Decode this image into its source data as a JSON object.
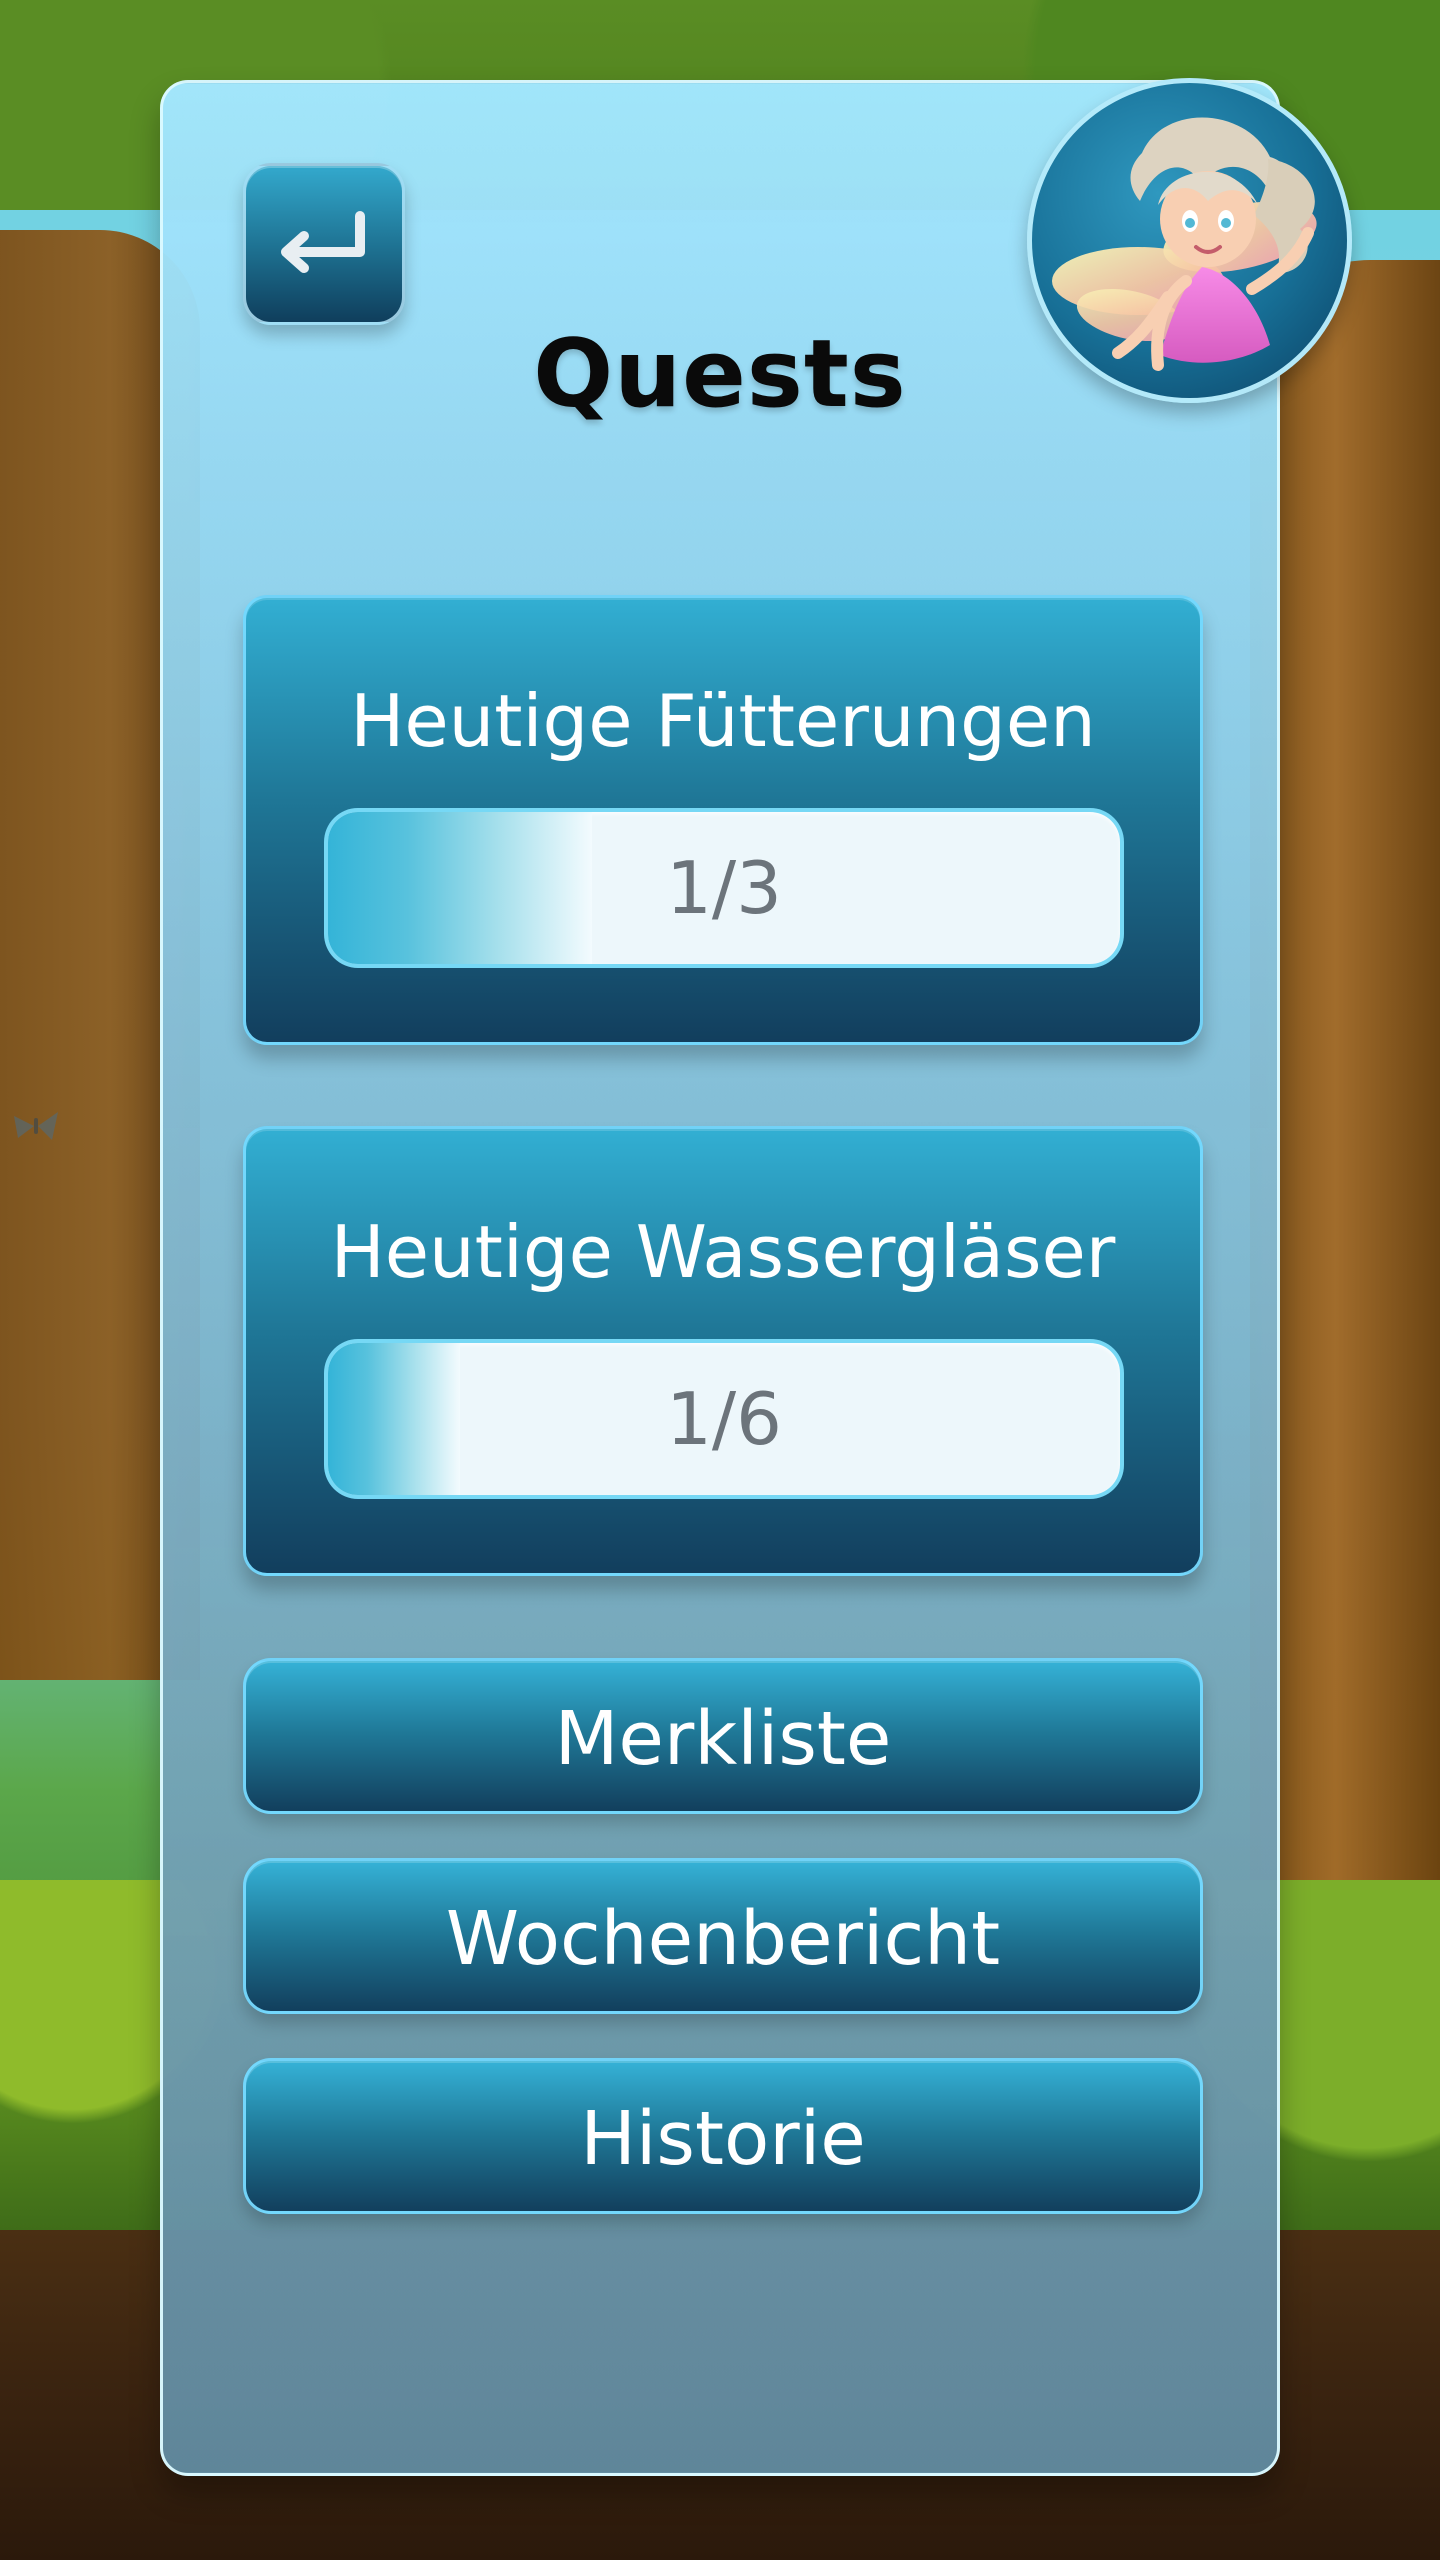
{
  "screen": {
    "title": "Quests"
  },
  "navigation": {
    "back_icon": "return-arrow-icon"
  },
  "avatar": {
    "icon": "fairy-avatar"
  },
  "quests": [
    {
      "title": "Heutige Fütterungen",
      "progress_text": "1/3",
      "progress_fraction": 0.3333
    },
    {
      "title": "Heutige Wassergläser",
      "progress_text": "1/6",
      "progress_fraction": 0.1667
    }
  ],
  "menu": {
    "items": [
      {
        "label": "Merkliste"
      },
      {
        "label": "Wochenbericht"
      },
      {
        "label": "Historie"
      }
    ]
  },
  "colors": {
    "panel_top": "#a3e7ff",
    "panel_bottom": "#61899e",
    "button_top": "#35b2d7",
    "button_bottom": "#123f5d",
    "title_text": "#0a0a0a",
    "progress_text": "#6c747b",
    "white_text": "#ffffff"
  }
}
